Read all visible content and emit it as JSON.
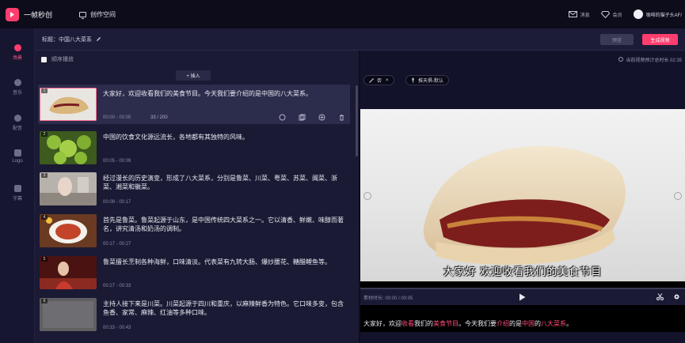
{
  "app": {
    "logo_text": "一帧秒创",
    "workspace_label": "创作空间",
    "top_right": {
      "message_label": "消息",
      "member_label": "会员",
      "username": "咖啡的猫子头AF/"
    }
  },
  "sidebar": {
    "items": [
      {
        "label": "场景",
        "icon": "scene-icon",
        "active": true
      },
      {
        "label": "音乐",
        "icon": "music-icon",
        "active": false
      },
      {
        "label": "配音",
        "icon": "voice-icon",
        "active": false
      },
      {
        "label": "Logo",
        "icon": "logo-icon",
        "active": false
      },
      {
        "label": "字幕",
        "icon": "subtitle-icon",
        "active": false
      }
    ]
  },
  "titlebar": {
    "title": "标题：中国八大菜系",
    "preview_button": "预览",
    "generate_button": "生成视频"
  },
  "list": {
    "order_checkbox_label": "顺序播放",
    "insert_button": "+ 插入",
    "rows": [
      {
        "num": "1",
        "text": "大家好，欢迎收看我们的美食节目。今天我们要介绍的是中国的八大菜系。",
        "time": "00:00 - 00:05",
        "count": "33 / 200",
        "selected": true,
        "thumb": "sandwich"
      },
      {
        "num": "2",
        "text": "中国的饮食文化源远流长，各地都有其独特的风味。",
        "time": "00:05 - 00:09",
        "count": "",
        "selected": false,
        "thumb": "broccoli"
      },
      {
        "num": "3",
        "text": "经过漫长的历史演变，形成了八大菜系，分别是鲁菜、川菜、粤菜、苏菜、闽菜、浙菜、湘菜和徽菜。",
        "time": "00:09 - 00:17",
        "count": "",
        "selected": false,
        "thumb": "kitchen"
      },
      {
        "num": "4",
        "text": "首先是鲁菜。鲁菜起源于山东，是中国传统四大菜系之一。它以清香、鲜嫩、味醇而著名，讲究清汤和奶汤的调制。",
        "time": "00:17 - 00:27",
        "count": "",
        "selected": false,
        "thumb": "plate"
      },
      {
        "num": "5",
        "text": "鲁菜擅长烹制各种海鲜，口味清淡。代表菜有九转大肠、爆炒腰花、糖醋鲤鱼等。",
        "time": "00:27 - 00:33",
        "count": "",
        "selected": false,
        "thumb": "person"
      },
      {
        "num": "6",
        "text": "主持人接下来是川菜。川菜起源于四川和重庆，以麻辣鲜香为特色。它口味多变，包含鱼香、家常、麻辣、红油等多种口味。",
        "time": "00:33 - 00:43",
        "count": "",
        "selected": false,
        "thumb": "grey"
      }
    ]
  },
  "preview": {
    "total_duration_label": "当前视频预计总时长 02:35",
    "chip_scene": "否",
    "chip_voice": "推天俱-默认",
    "video_subtitle": "大家好 欢迎收看我们的美食节目",
    "material_time": "素材时长: 00:00 / 00:05",
    "caption_parts": [
      {
        "text": "大家好，欢迎",
        "hl": false
      },
      {
        "text": "收看",
        "hl": true
      },
      {
        "text": "我们的",
        "hl": false
      },
      {
        "text": "美食节目",
        "hl": true
      },
      {
        "text": "。今天我们要",
        "hl": false
      },
      {
        "text": "介绍",
        "hl": true
      },
      {
        "text": "的是",
        "hl": false
      },
      {
        "text": "中国",
        "hl": true
      },
      {
        "text": "的",
        "hl": false
      },
      {
        "text": "八大菜系",
        "hl": true
      },
      {
        "text": "。",
        "hl": false
      }
    ]
  },
  "colors": {
    "accent": "#ff3d6e",
    "background": "#14142b",
    "panel": "#1a1a34"
  }
}
